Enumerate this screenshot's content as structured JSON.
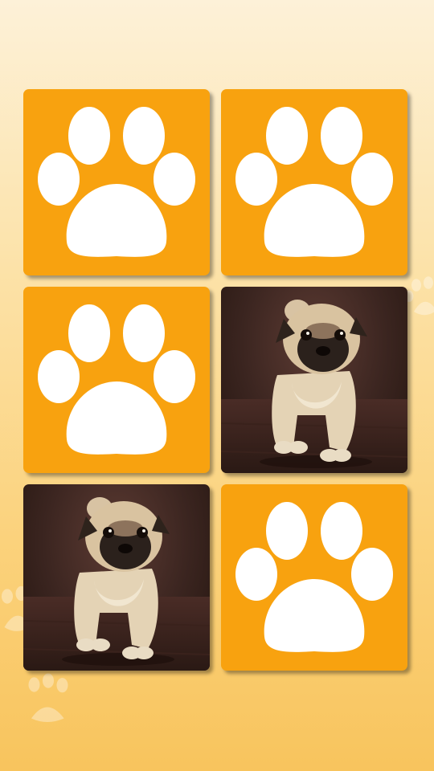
{
  "game": {
    "type": "memory-match",
    "card_back_icon": "paw-print-icon",
    "card_back_color": "#f8a20f",
    "background_colors": [
      "#fdf1d8",
      "#f8c45d"
    ]
  },
  "cards": [
    {
      "state": "hidden",
      "face": "paw-print"
    },
    {
      "state": "hidden",
      "face": "paw-print"
    },
    {
      "state": "hidden",
      "face": "paw-print"
    },
    {
      "state": "revealed",
      "face": "pug-puppy"
    },
    {
      "state": "revealed",
      "face": "pug-puppy"
    },
    {
      "state": "hidden",
      "face": "paw-print"
    }
  ]
}
